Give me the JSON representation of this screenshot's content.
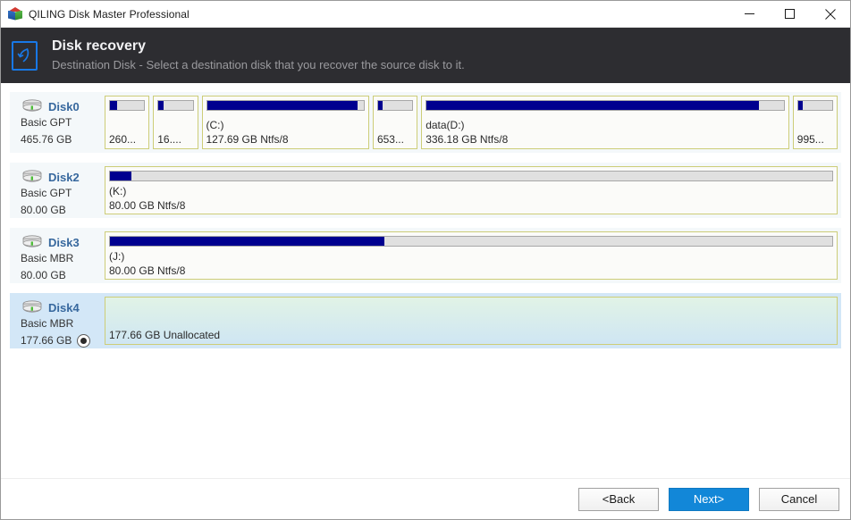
{
  "window": {
    "title": "QILING Disk Master Professional",
    "app_icon": "cube-icon",
    "controls": {
      "minimize": "minimize-icon",
      "maximize": "maximize-icon",
      "close": "close-icon"
    }
  },
  "header": {
    "icon": "recovery-swoosh-icon",
    "title": "Disk recovery",
    "subtitle": "Destination Disk - Select a destination disk that you recover the source disk to it.",
    "background_color": "#2d2d31",
    "accent_color": "#1878e6"
  },
  "disks": [
    {
      "name": "Disk0",
      "type": "Basic GPT",
      "size": "465.76 GB",
      "selected": false,
      "has_radio": false,
      "partitions": [
        {
          "label_top": "",
          "label_bottom": "260...",
          "used_percent": 22,
          "flex": 44,
          "unallocated": false
        },
        {
          "label_top": "",
          "label_bottom": "16....",
          "used_percent": 14,
          "flex": 44,
          "unallocated": false
        },
        {
          "label_top": "(C:)",
          "label_bottom": "127.69 GB Ntfs/8",
          "used_percent": 96,
          "flex": 194,
          "unallocated": false
        },
        {
          "label_top": "",
          "label_bottom": "653...",
          "used_percent": 14,
          "flex": 44,
          "unallocated": false
        },
        {
          "label_top": "data(D:)",
          "label_bottom": "336.18 GB Ntfs/8",
          "used_percent": 93,
          "flex": 439,
          "unallocated": false
        },
        {
          "label_top": "",
          "label_bottom": "995...",
          "used_percent": 14,
          "flex": 44,
          "unallocated": false
        }
      ]
    },
    {
      "name": "Disk2",
      "type": "Basic GPT",
      "size": "80.00 GB",
      "selected": false,
      "has_radio": false,
      "partitions": [
        {
          "label_top": "(K:)",
          "label_bottom": "80.00 GB Ntfs/8",
          "used_percent": 3,
          "flex": 100,
          "unallocated": false
        }
      ]
    },
    {
      "name": "Disk3",
      "type": "Basic MBR",
      "size": "80.00 GB",
      "selected": false,
      "has_radio": false,
      "partitions": [
        {
          "label_top": "(J:)",
          "label_bottom": "80.00 GB Ntfs/8",
          "used_percent": 38,
          "flex": 100,
          "unallocated": false
        }
      ]
    },
    {
      "name": "Disk4",
      "type": "Basic MBR",
      "size": "177.66 GB",
      "selected": true,
      "has_radio": true,
      "partitions": [
        {
          "label_top": "",
          "label_bottom": "177.66 GB Unallocated",
          "used_percent": 0,
          "flex": 100,
          "unallocated": true
        }
      ]
    }
  ],
  "footer": {
    "back_label": "<Back",
    "next_label": "Next>",
    "cancel_label": "Cancel",
    "primary_color": "#1287d8"
  }
}
